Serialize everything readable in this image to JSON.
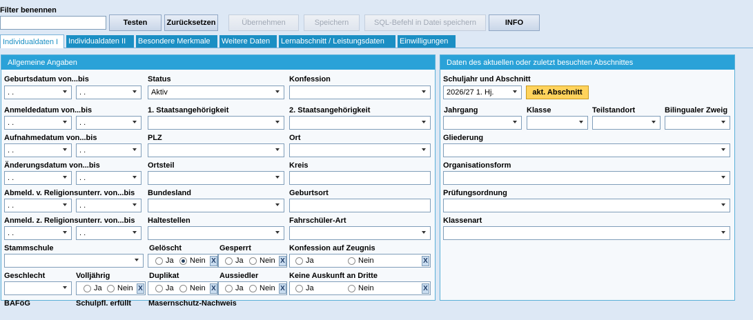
{
  "filter": {
    "label": "Filter benennen",
    "value": ""
  },
  "toolbar": {
    "testen": "Testen",
    "zuruecksetzen": "Zurücksetzen",
    "uebernehmen": "Übernehmen",
    "speichern": "Speichern",
    "sql": "SQL-Befehl in Datei speichern",
    "info": "INFO"
  },
  "tabs": [
    "Individualdaten I",
    "Individualdaten II",
    "Besondere Merkmale",
    "Weitere Daten",
    "Lernabschnitt / Leistungsdaten",
    "Einwilligungen"
  ],
  "left_panel": {
    "title": "Allgemeine Angaben",
    "date_placeholder": " .  .",
    "labels": {
      "geburtsdatum": "Geburtsdatum von...bis",
      "status": "Status",
      "konfession": "Konfession",
      "anmeldedatum": "Anmeldedatum von...bis",
      "staat1": "1. Staatsangehörigkeit",
      "staat2": "2. Staatsangehörigkeit",
      "aufnahmedatum": "Aufnahmedatum von...bis",
      "plz": "PLZ",
      "ort": "Ort",
      "aenderungsdatum": "Änderungsdatum von...bis",
      "ortsteil": "Ortsteil",
      "kreis": "Kreis",
      "abmeld": "Abmeld. v. Religionsunterr. von...bis",
      "bundesland": "Bundesland",
      "geburtsort": "Geburtsort",
      "anmeld": "Anmeld. z. Religionsunterr. von...bis",
      "haltestellen": "Haltestellen",
      "fahrschueler": "Fahrschüler-Art",
      "stammschule": "Stammschule",
      "geloescht": "Gelöscht",
      "gesperrt": "Gesperrt",
      "konf_zeugnis": "Konfession auf Zeugnis",
      "geschlecht": "Geschlecht",
      "volljaehrig": "Volljährig",
      "duplikat": "Duplikat",
      "aussiedler": "Aussiedler",
      "keine_auskunft": "Keine Auskunft an Dritte"
    },
    "status_value": "Aktiv",
    "ja": "Ja",
    "nein": "Nein",
    "clear": "X"
  },
  "right_panel": {
    "title": "Daten des aktuellen oder zuletzt besuchten Abschnittes",
    "labels": {
      "schuljahr": "Schuljahr und Abschnitt",
      "jahrgang": "Jahrgang",
      "klasse": "Klasse",
      "teilstandort": "Teilstandort",
      "bilingual": "Bilingualer Zweig",
      "gliederung": "Gliederung",
      "organisationsform": "Organisationsform",
      "pruefungsordnung": "Prüfungsordnung",
      "klassenart": "Klassenart"
    },
    "schuljahr_value": "2026/27 1. Hj.",
    "akt_button": "akt. Abschnitt"
  },
  "bottom_labels": {
    "bafoeg": "BAFöG",
    "schulpfl": "Schulpfl. erfüllt",
    "masern": "Masernschutz-Nachweis"
  }
}
